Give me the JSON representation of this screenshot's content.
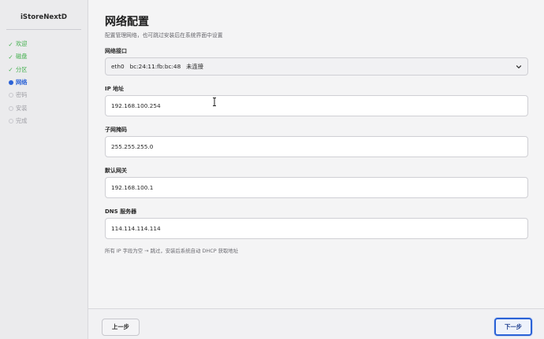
{
  "app": {
    "brand": "iStoreNextD"
  },
  "sidebar": {
    "steps": [
      {
        "label": "欢迎",
        "state": "done"
      },
      {
        "label": "磁盘",
        "state": "done"
      },
      {
        "label": "分区",
        "state": "done"
      },
      {
        "label": "网络",
        "state": "active"
      },
      {
        "label": "密码",
        "state": "todo"
      },
      {
        "label": "安装",
        "state": "todo"
      },
      {
        "label": "完成",
        "state": "todo"
      }
    ],
    "done_mark": "✓"
  },
  "main": {
    "title": "网络配置",
    "subtitle": "配置管理网络，也可跳过安装后在系统界面中设置",
    "interface": {
      "label": "网络接口",
      "value": "eth0   bc:24:11:fb:bc:48   未连接"
    },
    "ip": {
      "label": "IP 地址",
      "value": "192.168.100.254"
    },
    "netmask": {
      "label": "子网掩码",
      "value": "255.255.255.0"
    },
    "gateway": {
      "label": "默认网关",
      "value": "192.168.100.1"
    },
    "dns": {
      "label": "DNS 服务器",
      "value": "114.114.114.114"
    },
    "hint": "所有 IP 字段为空 → 跳过，安装后系统自动 DHCP 获取地址"
  },
  "footer": {
    "prev_label": "上一步",
    "next_label": "下一步"
  },
  "colors": {
    "accent": "#2b62d6",
    "done": "#3fae4a",
    "todo": "#a0a0a6"
  }
}
